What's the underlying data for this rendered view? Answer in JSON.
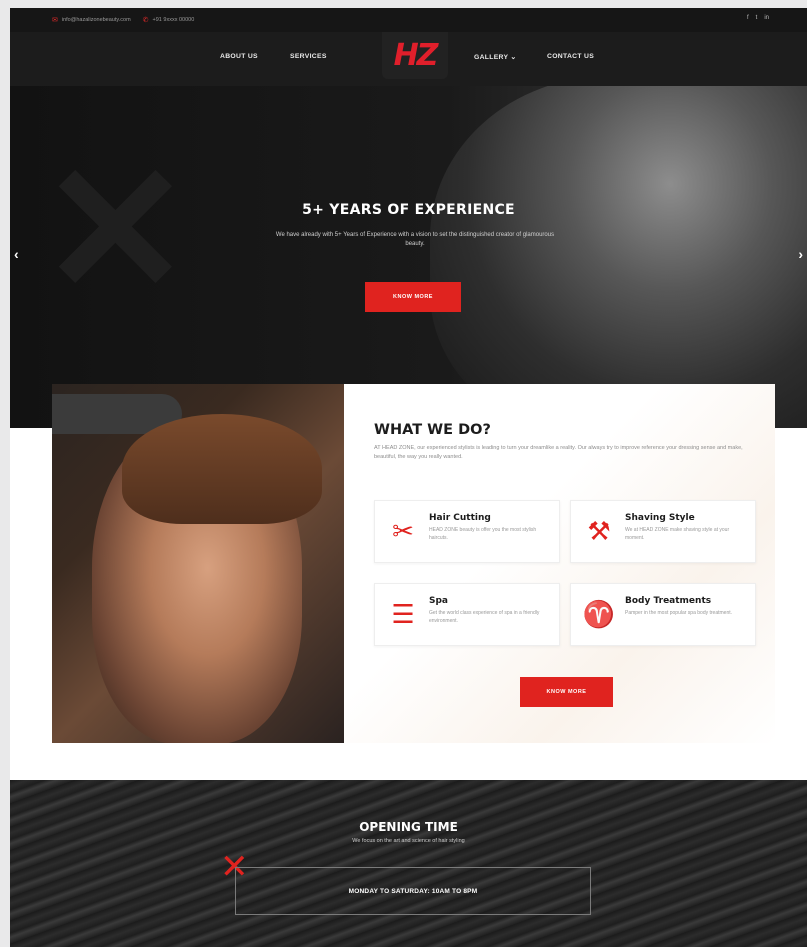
{
  "topbar": {
    "email": "info@hazalizonebeauty.com",
    "phone": "+91 9xxxx 00000",
    "social": [
      "f",
      "t",
      "in"
    ]
  },
  "nav": {
    "about": "ABOUT US",
    "services": "SERVICES",
    "logo": "HZ",
    "gallery": "GALLERY ⌄",
    "contact": "CONTACT US"
  },
  "hero": {
    "title": "5+ YEARS OF EXPERIENCE",
    "subtitle": "We have already with 5+ Years of Experience with a vision to set the distinguished creator of glamourous beauty.",
    "button": "KNOW MORE",
    "prev": "‹",
    "next": "›"
  },
  "what_we_do": {
    "title": "WHAT WE DO?",
    "description": "AT HEAD ZONE, our experienced stylists is leading to turn your dreamlike a reality. Our always try to improve reference your dressing sense and make, beautiful, the way you really wanted.",
    "cards": [
      {
        "title": "Hair Cutting",
        "text": "HEAD ZONE beauty is offer you the most stylish haircuts.",
        "icon": "scissors-comb-icon"
      },
      {
        "title": "Shaving Style",
        "text": "We at HEAD ZONE make shaving style at your moment.",
        "icon": "razor-icon"
      },
      {
        "title": "Spa",
        "text": "Get the world class experience of spa in a friendly environment.",
        "icon": "spa-stones-icon"
      },
      {
        "title": "Body Treatments",
        "text": "Pamper in the most popular spa body treatment.",
        "icon": "body-treatment-icon"
      }
    ],
    "button": "KNOW MORE"
  },
  "opening": {
    "title": "OPENING TIME",
    "subtitle": "We focus on the art and science of hair styling",
    "hours": "MONDAY TO SATURDAY: 10AM TO 8PM"
  }
}
